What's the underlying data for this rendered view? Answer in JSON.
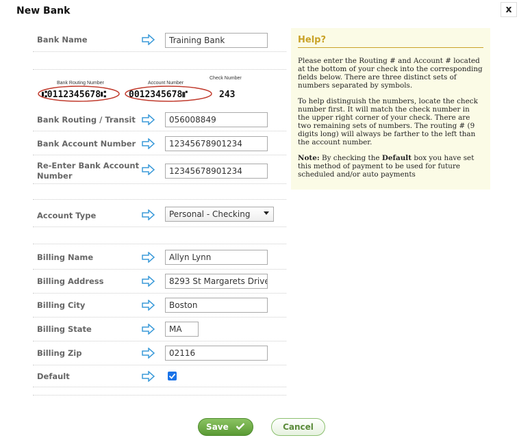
{
  "dialog": {
    "title": "New Bank",
    "close_label": "x"
  },
  "fields": {
    "bank_name": {
      "label": "Bank Name",
      "value": "Training Bank"
    },
    "routing": {
      "label": "Bank Routing / Transit",
      "value": "056008849"
    },
    "account": {
      "label": "Bank Account Number",
      "value": "12345678901234"
    },
    "reenter_account": {
      "label_line1": "Re-Enter Bank Account",
      "label_line2": "Number",
      "value": "12345678901234"
    },
    "account_type": {
      "label": "Account Type",
      "value": "Personal - Checking"
    },
    "billing_name": {
      "label": "Billing Name",
      "value": "Allyn Lynn"
    },
    "billing_address": {
      "label": "Billing Address",
      "value": "8293 St Margarets Drive"
    },
    "billing_city": {
      "label": "Billing City",
      "value": "Boston"
    },
    "billing_state": {
      "label": "Billing State",
      "value": "MA"
    },
    "billing_zip": {
      "label": "Billing Zip",
      "value": "02116"
    },
    "default": {
      "label": "Default",
      "checked": true
    }
  },
  "check_image": {
    "routing_caption": "Bank Routing Number",
    "account_caption": "Account Number",
    "check_caption": "Check Number",
    "routing_digits": "⑆0112345678⑆",
    "account_digits": "0012345678⑈",
    "check_digits": "243"
  },
  "help": {
    "title": "Help?",
    "para1": "Please enter the Routing # and Account # located at the bottom of your check into the corresponding fields below. There are three distinct sets of numbers separated by symbols.",
    "para2": "To help distinguish the numbers, locate the check number first. It will match the check number in the upper right corner of your check. There are two remaining sets of numbers. The routing # (9 digits long) will always be farther to the left than the account number.",
    "note_label": "Note:",
    "note_pre": " By checking the ",
    "note_bold": "Default",
    "note_post": " box you have set this method of payment to be used for future scheduled and/or auto payments"
  },
  "buttons": {
    "save": "Save",
    "cancel": "Cancel"
  },
  "colors": {
    "arrow": "#3a9ad9",
    "help_bg": "#fbfbe6",
    "help_title": "#c9a227",
    "save": "#6aaa3f",
    "checkbox": "#1a73e8"
  }
}
